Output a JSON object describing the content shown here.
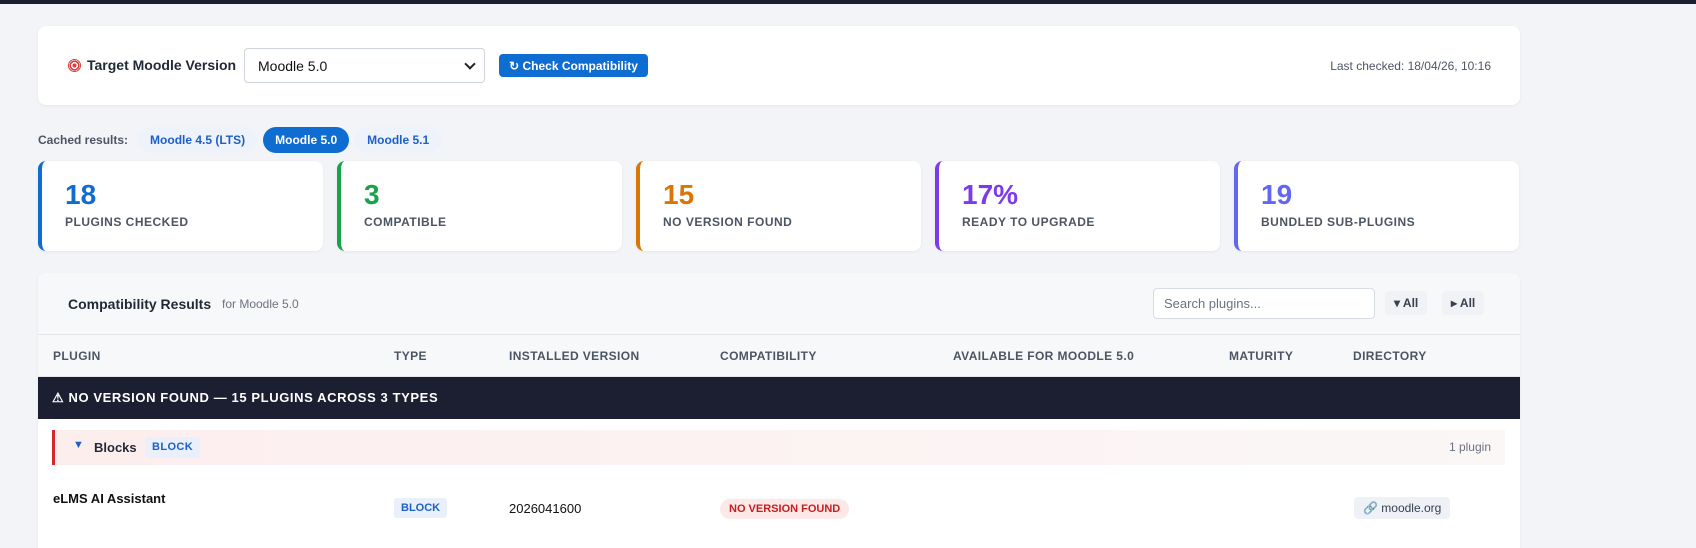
{
  "version_card": {
    "label": "Target Moodle Version",
    "selected_version": "Moodle 5.0",
    "check_button": "↻ Check Compatibility",
    "last_checked": "Last checked: 18/04/26, 10:16"
  },
  "cached": {
    "label": "Cached results:",
    "tabs": [
      "Moodle 4.5 (LTS)",
      "Moodle 5.0",
      "Moodle 5.1"
    ],
    "active": "Moodle 5.0"
  },
  "stats": [
    {
      "value": "18",
      "label": "PLUGINS CHECKED",
      "color": "#0f6cd1"
    },
    {
      "value": "3",
      "label": "COMPATIBLE",
      "color": "#16a34a"
    },
    {
      "value": "15",
      "label": "NO VERSION FOUND",
      "color": "#d97706"
    },
    {
      "value": "17%",
      "label": "READY TO UPGRADE",
      "color": "#7c3aed"
    },
    {
      "value": "19",
      "label": "BUNDLED SUB-PLUGINS",
      "color": "#6366f1"
    }
  ],
  "results": {
    "title": "Compatibility Results",
    "subtitle": "for Moodle 5.0",
    "search_placeholder": "Search plugins...",
    "collapse_all": "▾ All",
    "expand_all": "▸ All",
    "columns": [
      "PLUGIN",
      "TYPE",
      "INSTALLED VERSION",
      "COMPATIBILITY",
      "AVAILABLE FOR MOODLE 5.0",
      "MATURITY",
      "DIRECTORY"
    ],
    "group_banner": "⚠ NO VERSION FOUND — 15 PLUGINS ACROSS 3 TYPES",
    "subgroup": {
      "toggle": "▼",
      "name": "Blocks",
      "tag": "BLOCK",
      "count": "1 plugin"
    },
    "rows": [
      {
        "plugin": "eLMS AI Assistant",
        "type": "BLOCK",
        "installed": "2026041600",
        "compatibility": "NO VERSION FOUND",
        "directory": "🔗 moodle.org"
      }
    ]
  },
  "icons": {
    "target": "target-icon",
    "refresh": "refresh-icon",
    "warning": "warning-icon",
    "link": "link-icon"
  }
}
